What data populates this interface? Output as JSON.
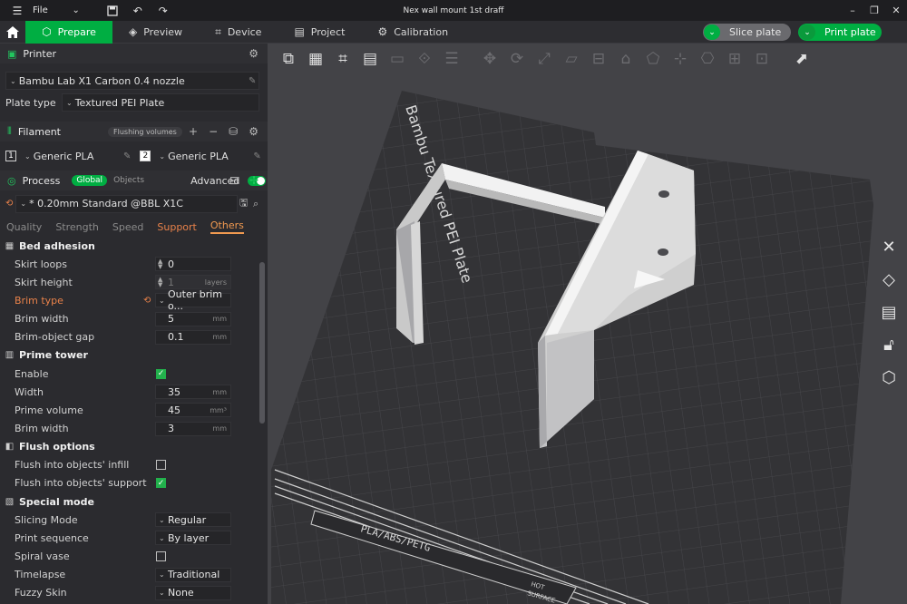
{
  "titlebar": {
    "file_label": "File",
    "window_title": "Nex wall mount 1st draff"
  },
  "tabs": [
    {
      "label": "Prepare",
      "icon": "cube-icon"
    },
    {
      "label": "Preview",
      "icon": "layers-icon"
    },
    {
      "label": "Device",
      "icon": "device-icon"
    },
    {
      "label": "Project",
      "icon": "project-icon"
    },
    {
      "label": "Calibration",
      "icon": "calibration-icon"
    }
  ],
  "actions": {
    "slice_label": "Slice plate",
    "print_label": "Print plate"
  },
  "printer": {
    "section_label": "Printer",
    "printer_name": "Bambu Lab X1 Carbon 0.4 nozzle",
    "plate_type_label": "Plate type",
    "plate_type_value": "Textured PEI Plate"
  },
  "filament": {
    "section_label": "Filament",
    "flushing_label": "Flushing volumes",
    "slots": [
      {
        "num": "1",
        "name": "Generic PLA"
      },
      {
        "num": "2",
        "name": "Generic PLA"
      }
    ]
  },
  "process": {
    "section_label": "Process",
    "global_label": "Global",
    "objects_label": "Objects",
    "advanced_label": "Advanced",
    "preset": "* 0.20mm Standard @BBL X1C",
    "subtabs": [
      "Quality",
      "Strength",
      "Speed",
      "Support",
      "Others"
    ]
  },
  "groups": {
    "bed_adhesion": {
      "title": "Bed adhesion",
      "skirt_loops_label": "Skirt loops",
      "skirt_loops": "0",
      "skirt_height_label": "Skirt height",
      "skirt_height": "1",
      "skirt_height_unit": "layers",
      "brim_type_label": "Brim type",
      "brim_type": "Outer brim o...",
      "brim_width_label": "Brim width",
      "brim_width": "5",
      "brim_width_unit": "mm",
      "brim_gap_label": "Brim-object gap",
      "brim_gap": "0.1",
      "brim_gap_unit": "mm"
    },
    "prime_tower": {
      "title": "Prime tower",
      "enable_label": "Enable",
      "width_label": "Width",
      "width": "35",
      "width_unit": "mm",
      "volume_label": "Prime volume",
      "volume": "45",
      "volume_unit": "mm³",
      "brim_width_label": "Brim width",
      "brim_width": "3",
      "brim_width_unit": "mm"
    },
    "flush_options": {
      "title": "Flush options",
      "infill_label": "Flush into objects' infill",
      "support_label": "Flush into objects' support"
    },
    "special_mode": {
      "title": "Special mode",
      "slicing_mode_label": "Slicing Mode",
      "slicing_mode": "Regular",
      "print_sequence_label": "Print sequence",
      "print_sequence": "By layer",
      "spiral_vase_label": "Spiral vase",
      "timelapse_label": "Timelapse",
      "timelapse": "Traditional",
      "fuzzy_skin_label": "Fuzzy Skin",
      "fuzzy_skin": "None"
    }
  },
  "plate": {
    "brand_text": "Bambu Textured PEI Plate",
    "material_text": "PLA/ABS/PETG",
    "hot_text": "HOT",
    "surface_text": "SURFACE"
  },
  "colors": {
    "accent": "#00ae42",
    "orange": "#e9824a"
  }
}
